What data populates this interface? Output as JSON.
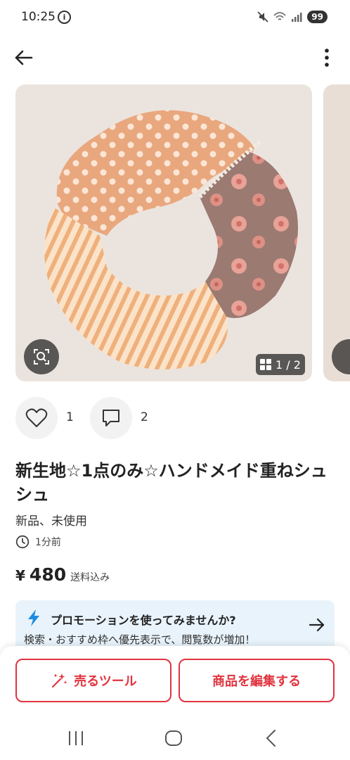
{
  "status_bar": {
    "time": "10:25",
    "battery": "99",
    "info_icon": "info-icon",
    "mute_icon": "mute-icon",
    "wifi_icon": "wifi-icon",
    "signal_icon": "signal-icon"
  },
  "app_bar": {
    "back_icon": "back-arrow-icon",
    "more_icon": "more-vertical-icon"
  },
  "carousel": {
    "page_indicator": "1 / 2",
    "current_page": 1,
    "total_pages": 2
  },
  "reactions": {
    "like_count": "1",
    "comment_count": "2"
  },
  "product": {
    "title": "新生地☆1点のみ☆ハンドメイド重ねシュシュ",
    "condition": "新品、未使用",
    "posted": "1分前",
    "price_symbol": "¥",
    "price": "480",
    "shipping": "送料込み"
  },
  "promotion": {
    "title": "プロモーションを使ってみませんか?",
    "description": "検索・おすすめ枠へ優先表示で、閲覧数が増加！"
  },
  "actions": {
    "sell_tools_label": "売るツール",
    "edit_item_label": "商品を編集する"
  },
  "colors": {
    "accent_red": "#e0343f",
    "promo_bg": "#e8f3fb",
    "promo_bolt": "#1a8de0"
  }
}
